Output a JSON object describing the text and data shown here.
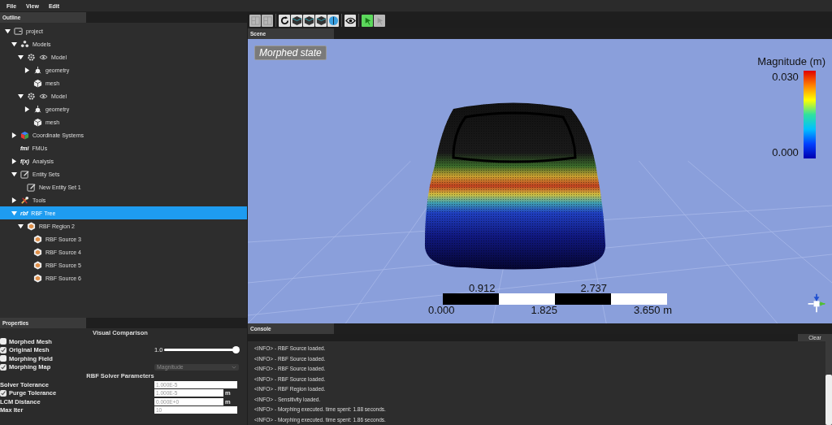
{
  "menu": [
    "File",
    "View",
    "Edit"
  ],
  "outline": {
    "title": "Outline",
    "tree": [
      {
        "label": "project",
        "kind": "folder",
        "expanded": true,
        "selected": false,
        "children": [
          {
            "label": "Models",
            "kind": "models",
            "expanded": true,
            "selected": false,
            "children": [
              {
                "label": "Model",
                "kind": "model",
                "expanded": true,
                "selected": false,
                "children": [
                  {
                    "label": "geometry",
                    "kind": "geometry",
                    "expanded": false,
                    "selected": false
                  },
                  {
                    "label": "mesh",
                    "kind": "mesh",
                    "selected": false
                  }
                ]
              },
              {
                "label": "Model",
                "kind": "model",
                "expanded": true,
                "selected": false,
                "children": [
                  {
                    "label": "geometry",
                    "kind": "geometry",
                    "expanded": false,
                    "selected": false
                  },
                  {
                    "label": "mesh",
                    "kind": "mesh",
                    "selected": false
                  }
                ]
              }
            ]
          },
          {
            "label": "Coordinate Systems",
            "kind": "coords",
            "expanded": false,
            "selected": false
          },
          {
            "label": "FMUs",
            "kind": "badge",
            "icon_text": "fmi",
            "selected": false
          },
          {
            "label": "Analysis",
            "kind": "badge",
            "icon_text": "f(x)",
            "expanded": false,
            "selected": false
          },
          {
            "label": "Entity Sets",
            "kind": "entityset",
            "expanded": true,
            "selected": false,
            "children": [
              {
                "label": "New Entity Set 1",
                "kind": "entityset",
                "selected": false
              }
            ]
          },
          {
            "label": "Tools",
            "kind": "tools",
            "expanded": false,
            "selected": false
          },
          {
            "label": "RBF Tree",
            "kind": "badge",
            "icon_text": "rbf",
            "expanded": true,
            "selected": true,
            "children": [
              {
                "label": "RBF Region 2",
                "kind": "source",
                "expanded": true,
                "selected": false,
                "children": [
                  {
                    "label": "RBF Source 3",
                    "kind": "source",
                    "selected": false
                  },
                  {
                    "label": "RBF Source 4",
                    "kind": "source",
                    "selected": false
                  },
                  {
                    "label": "RBF Source 5",
                    "kind": "source",
                    "selected": false
                  },
                  {
                    "label": "RBF Source 6",
                    "kind": "source",
                    "selected": false
                  }
                ]
              }
            ]
          }
        ]
      }
    ]
  },
  "properties": {
    "title": "Properties",
    "sections": [
      {
        "title": "Visual Comparison",
        "rows": [
          {
            "kind": "check",
            "label": "Morphed Mesh",
            "checked": false
          },
          {
            "kind": "slider",
            "label": "Original Mesh",
            "checked": true,
            "reading": "1.0",
            "level": 1.0
          },
          {
            "kind": "check",
            "label": "Morphing Field",
            "checked": false
          },
          {
            "kind": "dropdown",
            "label": "Morphing Map",
            "checked": true,
            "value": "Magnitude"
          }
        ]
      },
      {
        "title": "RBF Solver Parameters",
        "rows": [
          {
            "kind": "field",
            "label": "Solver Tolerance",
            "value": "1.000E-5"
          },
          {
            "kind": "field",
            "label": "Purge Tolerance",
            "checked": true,
            "value": "1.000E-5",
            "unit": "m"
          },
          {
            "kind": "field",
            "label": "LCM Distance",
            "value": "0.000E+0",
            "unit": "m"
          },
          {
            "kind": "field",
            "label": "Max Iter",
            "value": "10"
          }
        ]
      }
    ]
  },
  "toolbar": [
    {
      "kind": "layout",
      "disabled": true,
      "selected": false
    },
    {
      "kind": "layout",
      "disabled": true,
      "selected": false
    },
    {
      "kind": "rotate",
      "disabled": false,
      "selected": false
    },
    {
      "kind": "cube",
      "disabled": false,
      "selected": false
    },
    {
      "kind": "cube",
      "disabled": false,
      "selected": false
    },
    {
      "kind": "cube",
      "disabled": false,
      "selected": false
    },
    {
      "kind": "sphere",
      "disabled": false,
      "selected": false
    },
    {
      "kind": "eye",
      "disabled": false,
      "selected": false
    },
    {
      "kind": "pointer",
      "disabled": false,
      "selected": true
    },
    {
      "kind": "pointer",
      "disabled": true,
      "selected": false
    }
  ],
  "scene": {
    "title": "Scene",
    "state_label": "Morphed state",
    "colorbar": {
      "title": "Magnitude (m)",
      "max": "0.030",
      "min": "0.000"
    },
    "scale_bar": {
      "top_labels": [
        "0.912",
        "2.737"
      ],
      "bottom_labels": [
        "0.000",
        "1.825",
        "3.650 m"
      ]
    }
  },
  "console": {
    "title": "Console",
    "clear": "Clear",
    "lines": [
      "<INFO> - RBF Source loaded.",
      "<INFO> - RBF Source loaded.",
      "<INFO> - RBF Source loaded.",
      "<INFO> - RBF Source loaded.",
      "<INFO> - RBF Region loaded.",
      "<INFO> - Sensitivity loaded.",
      "<INFO> - Morphing executed. time spent: 1.88 seconds.",
      "<INFO> - Morphing executed. time spent: 1.86 seconds."
    ]
  }
}
